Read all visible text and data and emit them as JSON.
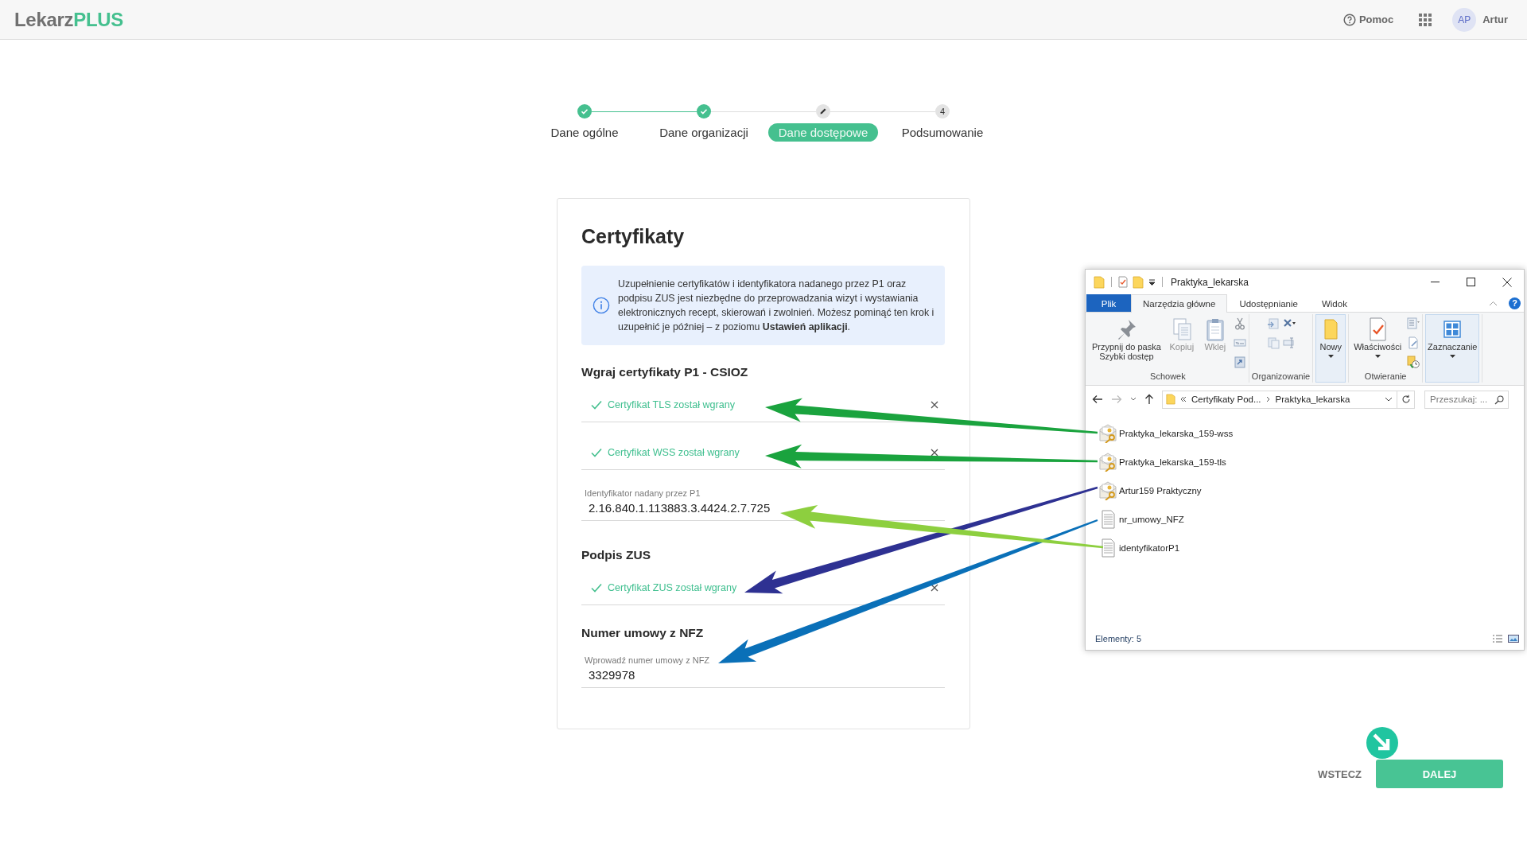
{
  "header": {
    "logo": {
      "first": "Lekarz",
      "second": "PLUS"
    },
    "help": "Pomoc",
    "user": {
      "initials": "AP",
      "name": "Artur"
    }
  },
  "steps": [
    {
      "label": "Dane ogólne",
      "completed": true,
      "selected": false
    },
    {
      "label": "Dane organizacji",
      "completed": true,
      "selected": false
    },
    {
      "label": "Dane dostępowe",
      "completed": false,
      "selected": true
    },
    {
      "label": "Podsumowanie",
      "completed": false,
      "selected": false,
      "number": "4"
    }
  ],
  "card": {
    "title": "Certyfikaty",
    "info": "Uzupełnienie certyfikatów i identyfikatora nadanego przez P1 oraz podpisu ZUS jest niezbędne do przeprowadzania wizyt i wystawiania elektronicznych recept, skierowań i zwolnień. Możesz pominąć ten krok i uzupełnić je później – z poziomu **Ustawień aplikacji**.",
    "sections": [
      {
        "heading": "Wgraj certyfikaty P1 - CSIOZ",
        "items": [
          {
            "kind": "upload",
            "text": "Certyfikat TLS został wgrany",
            "uploaded": true
          },
          {
            "kind": "upload",
            "text": "Certyfikat WSS został wgrany",
            "uploaded": true
          },
          {
            "kind": "field",
            "label": "Identyfikator nadany przez P1",
            "value": "2.16.840.1.113883.3.4424.2.7.725"
          }
        ]
      },
      {
        "heading": "Podpis ZUS",
        "items": [
          {
            "kind": "upload",
            "text": "Certyfikat ZUS został wgrany",
            "uploaded": true
          }
        ]
      },
      {
        "heading": "Numer umowy z NFZ",
        "items": [
          {
            "kind": "field",
            "label": "Wprowadź numer umowy z NFZ",
            "value": "3329978"
          }
        ]
      }
    ]
  },
  "explorer": {
    "title": "Praktyka_lekarska",
    "tabs": [
      {
        "label": "Plik",
        "kind": "file",
        "selected": false
      },
      {
        "label": "Narzędzia główne",
        "kind": "tab",
        "selected": true
      },
      {
        "label": "Udostępnianie",
        "kind": "tab",
        "selected": false
      },
      {
        "label": "Widok",
        "kind": "tab",
        "selected": false
      }
    ],
    "help": "?",
    "groups": [
      {
        "label": "Schowek",
        "tools": [
          {
            "kind": "pin",
            "label": "Przypnij do paska\nSzybki dostęp",
            "disabled": false,
            "dropdown": false,
            "highlighted": false
          },
          {
            "kind": "copy",
            "label": "Kopiuj",
            "disabled": true,
            "dropdown": false,
            "highlighted": false
          },
          {
            "kind": "paste",
            "label": "Wklej",
            "disabled": true,
            "dropdown": false,
            "highlighted": false
          },
          {
            "kind": "stack",
            "tools": [
              {
                "kind": "cut"
              },
              {
                "kind": "copy-path"
              },
              {
                "kind": "paste-shortcut"
              }
            ]
          }
        ]
      },
      {
        "label": "Organizowanie",
        "tools": [
          {
            "kind": "stack",
            "tools": [
              {
                "kind": "move-to"
              },
              {
                "kind": "copy-to"
              }
            ]
          },
          {
            "kind": "stack",
            "tools": [
              {
                "kind": "delete"
              },
              {
                "kind": "rename"
              }
            ]
          }
        ]
      },
      {
        "tools": [
          {
            "kind": "new-folder",
            "label": "Nowy",
            "disabled": false,
            "dropdown": true,
            "highlighted": true
          }
        ]
      },
      {
        "label": "Otwieranie",
        "tools": [
          {
            "kind": "properties",
            "label": "Właściwości",
            "disabled": false,
            "dropdown": true,
            "highlighted": false
          },
          {
            "kind": "stack",
            "tools": [
              {
                "kind": "open"
              },
              {
                "kind": "edit"
              },
              {
                "kind": "history"
              }
            ]
          }
        ]
      },
      {
        "tools": [
          {
            "kind": "select",
            "label": "Zaznaczanie",
            "disabled": false,
            "dropdown": true,
            "highlighted": true
          }
        ]
      }
    ],
    "address": {
      "segments": [
        "Certyfikaty Pod...",
        "Praktyka_lekarska"
      ]
    },
    "search": {
      "placeholder": "Przeszukaj: ..."
    },
    "files": [
      {
        "name": "Praktyka_lekarska_159-wss",
        "kind": "certificate"
      },
      {
        "name": "Praktyka_lekarska_159-tls",
        "kind": "certificate"
      },
      {
        "name": "Artur159 Praktyczny",
        "kind": "certificate"
      },
      {
        "name": "nr_umowy_NFZ",
        "kind": "text"
      },
      {
        "name": "identyfikatorP1",
        "kind": "text"
      }
    ],
    "status": "Elementy: 5"
  },
  "footer": {
    "back": "WSTECZ",
    "next": "DALEJ"
  }
}
